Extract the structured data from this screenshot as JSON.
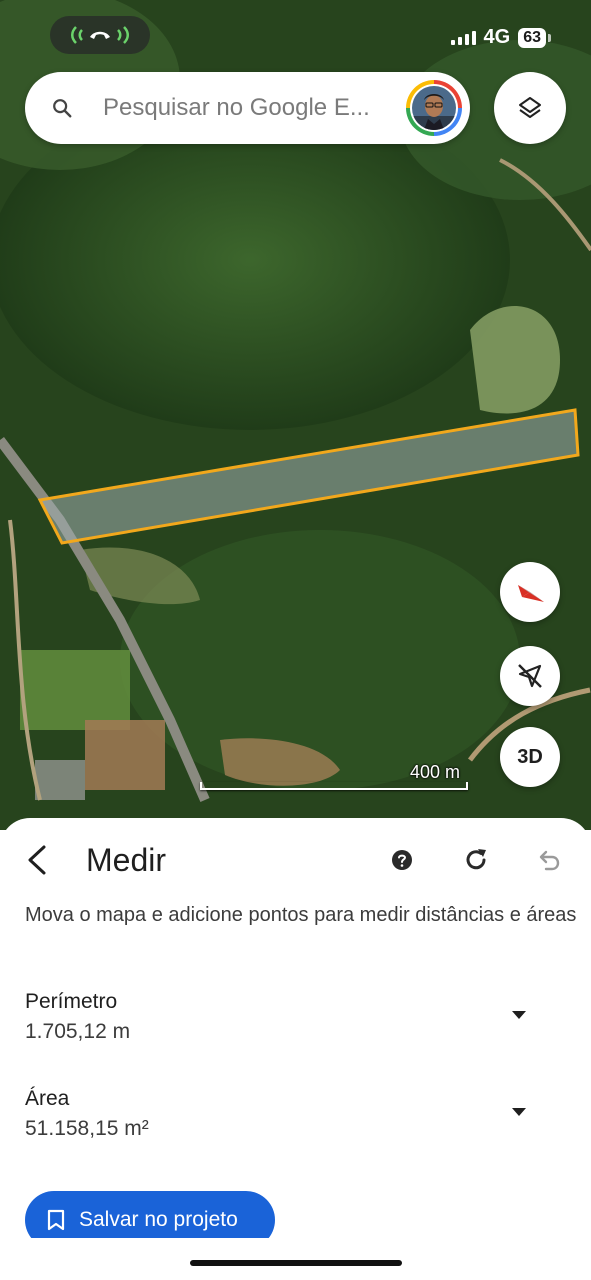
{
  "status_bar": {
    "network": "4G",
    "battery": "63"
  },
  "search": {
    "placeholder": "Pesquisar no Google E..."
  },
  "map": {
    "scale_label": "400 m",
    "btn_3d": "3D"
  },
  "measure_panel": {
    "title": "Medir",
    "description": "Mova o mapa e adicione pontos para medir distâncias e áreas",
    "perimeter": {
      "label": "Perímetro",
      "value": "1.705,12 m"
    },
    "area": {
      "label": "Área",
      "value": "51.158,15 m²"
    },
    "save_label": "Salvar no projeto"
  },
  "colors": {
    "accent": "#1a63d8",
    "polygon_outline": "#f2a81c",
    "sheet_bg": "#ffffff"
  },
  "icons": [
    "call-active-icon",
    "search-icon",
    "layers-icon",
    "compass-icon",
    "location-off-icon",
    "back-icon",
    "help-icon",
    "redo-icon",
    "undo-icon",
    "caret-down-icon",
    "bookmark-icon"
  ]
}
